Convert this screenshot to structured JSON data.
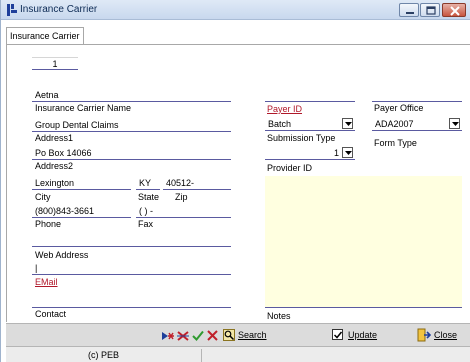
{
  "window": {
    "title": "Insurance Carrier"
  },
  "tab": {
    "label": "Insurance Carrier"
  },
  "record": {
    "number": "1"
  },
  "form": {
    "carrier_name_value": "Aetna",
    "carrier_name_label": "Insurance Carrier Name",
    "address1_value": "Group Dental Claims",
    "address1_label": "Address1",
    "address2_value": "Po Box 14066",
    "address2_label": "Address2",
    "city_value": "Lexington",
    "city_label": "City",
    "state_value": "KY",
    "state_label": "State",
    "zip_value": "40512-",
    "zip_label": "Zip",
    "phone_value": "(800)843-3661",
    "phone_label": "Phone",
    "fax_value": "(   )    -",
    "fax_label": "Fax",
    "web_label": "Web Address",
    "email_value": "|",
    "email_label": "EMail",
    "contact_label": "Contact",
    "payer_id_label": "Payer ID",
    "payer_office_label": "Payer Office",
    "submission_value": "Batch",
    "submission_label": "Submission Type",
    "form_type_value": "ADA2007",
    "form_type_label": "Form Type",
    "provider_value": "1",
    "provider_label": "Provider ID",
    "notes_label": "Notes"
  },
  "toolbar": {
    "search_label": "Search",
    "update_label": "Update",
    "update_checked": true,
    "close_label": "Close"
  },
  "status": {
    "text": "(c) PEB"
  },
  "colors": {
    "accent": "#1f3f9a",
    "required_label": "#b0182a",
    "notes_bg": "#ffffe0"
  }
}
